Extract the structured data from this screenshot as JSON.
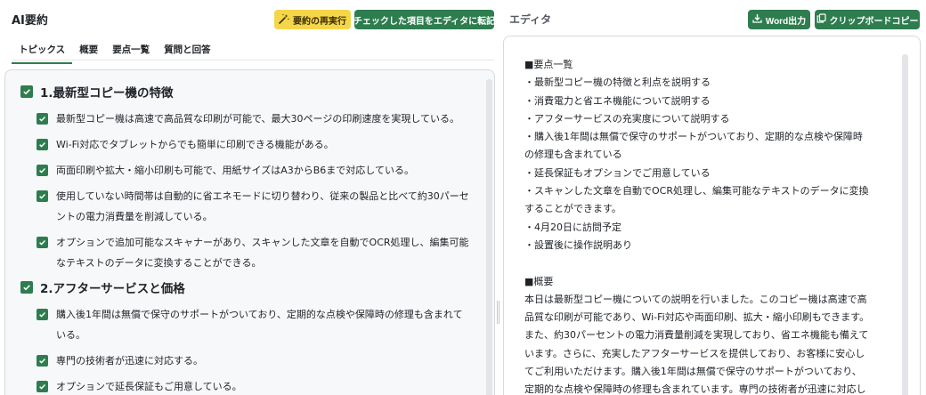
{
  "left": {
    "title": "AI要約",
    "rerun_label": "要約の再実行",
    "transfer_label": "チェックした項目をエディタに転記",
    "tabs": [
      {
        "label": "トピックス",
        "active": true
      },
      {
        "label": "概要",
        "active": false
      },
      {
        "label": "要点一覧",
        "active": false
      },
      {
        "label": "質問と回答",
        "active": false
      }
    ],
    "sections": [
      {
        "title": "1.最新型コピー機の特徴",
        "checked": true,
        "items": [
          {
            "text": "最新型コピー機は高速で高品質な印刷が可能で、最大30ページの印刷速度を実現している。",
            "checked": true
          },
          {
            "text": "Wi-Fi対応でタブレットからでも簡単に印刷できる機能がある。",
            "checked": true
          },
          {
            "text": "両面印刷や拡大・縮小印刷も可能で、用紙サイズはA3からB6まで対応している。",
            "checked": true
          },
          {
            "text": "使用していない時間帯は自動的に省エネモードに切り替わり、従来の製品と比べて約30パーセントの電力消費量を削減している。",
            "checked": true
          },
          {
            "text": "オプションで追加可能なスキャナーがあり、スキャンした文章を自動でOCR処理し、編集可能なテキストのデータに変換することができる。",
            "checked": true
          }
        ]
      },
      {
        "title": "2.アフターサービスと価格",
        "checked": true,
        "items": [
          {
            "text": "購入後1年間は無償で保守のサポートがついており、定期的な点検や保障時の修理も含まれている。",
            "checked": true
          },
          {
            "text": "専門の技術者が迅速に対応する。",
            "checked": true
          },
          {
            "text": "オプションで延長保証もご用意している。",
            "checked": true
          }
        ]
      }
    ]
  },
  "right": {
    "title": "エディタ",
    "word_label": "Word出力",
    "clipboard_label": "クリップボードコピー",
    "lines": [
      "■要点一覧",
      "・最新型コピー機の特徴と利点を説明する",
      "・消費電力と省エネ機能について説明する",
      "・アフターサービスの充実度について説明する",
      "・購入後1年間は無償で保守のサポートがついており、定期的な点検や保障時",
      "の修理も含まれている",
      "・延長保証もオプションでご用意している",
      "・スキャンした文章を自動でOCR処理し、編集可能なテキストのデータに変換",
      "することができます。",
      "・4月20日に訪問予定",
      "・設置後に操作説明あり",
      "",
      "■概要",
      "本日は最新型コピー機についての説明を行いました。このコピー機は高速で高",
      "品質な印刷が可能であり、Wi-Fi対応や両面印刷、拡大・縮小印刷もできます。",
      "また、約30パーセントの電力消費量削減を実現しており、省エネ機能も備えて",
      "います。さらに、充実したアフターサービスを提供しており、お客様に安心し",
      "てご利用いただけます。購入後1年間は無償で保守のサポートがついており、",
      "定期的な点検や保障時の修理も含まれています。専門の技術者が迅速に対応し"
    ]
  },
  "colors": {
    "accent_green": "#2e7d4f",
    "accent_yellow": "#f5d64a"
  }
}
